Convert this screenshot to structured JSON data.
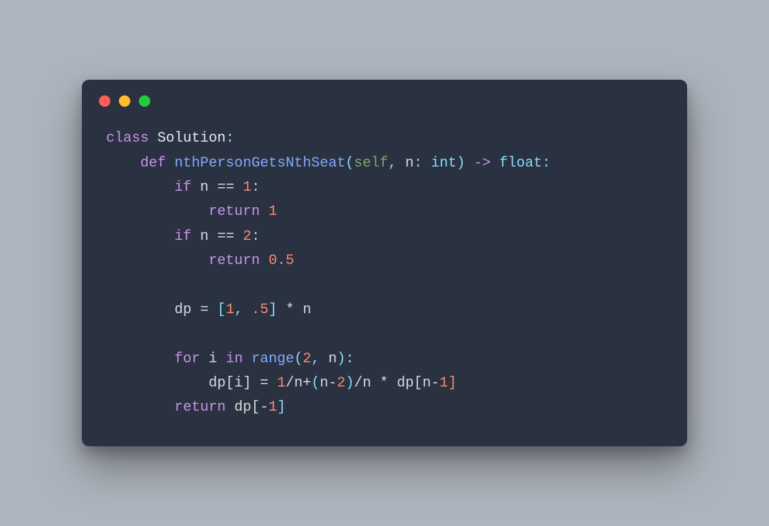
{
  "window": {
    "traffic_lights": [
      "red",
      "yellow",
      "green"
    ]
  },
  "code": {
    "kw_class": "class",
    "class_name": "Solution",
    "colon": ":",
    "kw_def": "def",
    "fn_name": "nthPersonGetsNthSeat",
    "lparen": "(",
    "self": "self",
    "comma_sp": ", ",
    "param_n": "n",
    "type_int": "int",
    "rparen": ")",
    "arrow": " -> ",
    "type_float": "float",
    "kw_if": "if",
    "eqeq": " == ",
    "num_1": "1",
    "kw_return": "return",
    "num_2": "2",
    "num_0_5": "0.5",
    "id_dp": "dp",
    "assign": " = ",
    "lbrack": "[",
    "comma_sp2": ", ",
    "num_p5": ".5",
    "rbrack": "]",
    "star_n": " * n",
    "kw_for": "for",
    "id_i": "i",
    "kw_in": "in",
    "fn_range": "range",
    "range_args_open": "(",
    "range_arg1": "2",
    "range_args_close": ")",
    "param_n2": "n",
    "dp_i_lhs": "dp[i]",
    "expr_eq": " = ",
    "expr_1": "1",
    "slash": "/",
    "expr_n": "n",
    "plus": "+",
    "l2": "(",
    "nminus2_n": "n",
    "minus": "-",
    "two": "2",
    "r2": ")",
    "times": " * ",
    "dp_nm1": "dp[n",
    "neg1close": "1]",
    "ret_dp_neg1_open": "dp[",
    "neg": "-",
    "one_b": "1",
    "close_b": "]"
  }
}
